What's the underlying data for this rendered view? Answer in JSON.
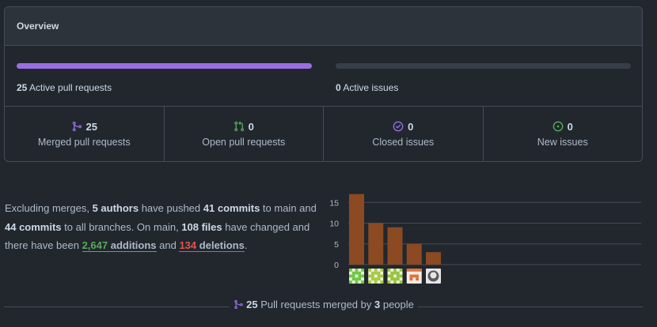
{
  "overview": {
    "title": "Overview",
    "pr_bar": {
      "count": "25",
      "label": "Active pull requests",
      "fill_fraction": 1.0,
      "color": "#986ee2"
    },
    "issue_bar": {
      "count": "0",
      "label": "Active issues",
      "fill_fraction": 0.0,
      "color": "#373e47"
    },
    "stats": [
      {
        "value": "25",
        "label": "Merged pull requests",
        "icon": "git-merge-icon",
        "color": "#986ee2"
      },
      {
        "value": "0",
        "label": "Open pull requests",
        "icon": "git-pull-request-icon",
        "color": "#57ab5a"
      },
      {
        "value": "0",
        "label": "Closed issues",
        "icon": "issue-closed-icon",
        "color": "#986ee2"
      },
      {
        "value": "0",
        "label": "New issues",
        "icon": "issue-opened-icon",
        "color": "#57ab5a"
      }
    ]
  },
  "summary": {
    "t1": "Excluding merges, ",
    "authors": "5 authors",
    "t2": " have pushed ",
    "commits_main": "41 commits",
    "t3": " to main and ",
    "commits_all": "44 commits",
    "t4": " to all branches. On main, ",
    "files": "108 files",
    "t5": " have changed and there have been ",
    "additions_num": "2,647",
    "additions_word": "additions",
    "t6": " and ",
    "deletions_num": "134",
    "deletions_word": "deletions",
    "t7": "."
  },
  "chart_data": {
    "type": "bar",
    "categories": [
      "contributor-1",
      "contributor-2",
      "contributor-3",
      "contributor-4",
      "contributor-5"
    ],
    "values": [
      17,
      10,
      9,
      5,
      3
    ],
    "ylim": [
      0,
      18
    ],
    "yticks": [
      "15",
      "10",
      "5",
      "0"
    ],
    "grid": true,
    "bar_color": "#8b4a22",
    "avatar_icons": [
      "green-identicon",
      "green-identicon",
      "green-identicon",
      "orange-identicon",
      "github-octocat-icon"
    ]
  },
  "footer": {
    "count": "25",
    "t1": " Pull requests merged by ",
    "people": "3",
    "t2": " people"
  }
}
